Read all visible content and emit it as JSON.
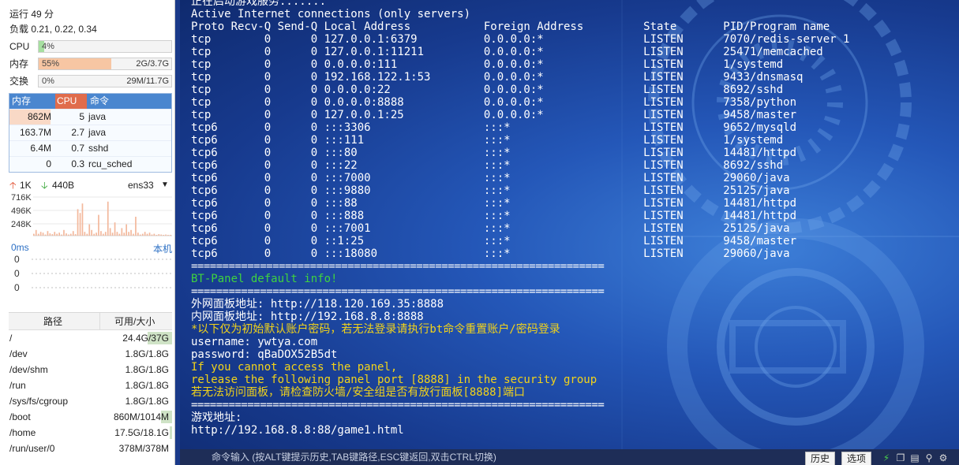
{
  "sidebar": {
    "uptime": "运行 49 分",
    "load": "负载 0.21, 0.22, 0.34",
    "cpu": {
      "label": "CPU",
      "pct_text": "4%",
      "value": 0.04,
      "color": "#a6dfa0"
    },
    "mem": {
      "label": "内存",
      "pct_text": "55%",
      "amount": "2G/3.7G",
      "value": 0.55,
      "color": "#f7c6a3"
    },
    "swap": {
      "label": "交换",
      "pct_text": "0%",
      "amount": "29M/11.7G",
      "value": 0.0,
      "color": "#cfe3f7"
    },
    "process_table": {
      "headers": {
        "mem": "内存",
        "cpu": "CPU",
        "cmd": "命令"
      },
      "rows": [
        {
          "mem": "862M",
          "cpu": "5",
          "cmd": "java",
          "mem_frac": 0.25
        },
        {
          "mem": "163.7M",
          "cpu": "2.7",
          "cmd": "java",
          "mem_frac": 0.0
        },
        {
          "mem": "6.4M",
          "cpu": "0.7",
          "cmd": "sshd",
          "mem_frac": 0.0
        },
        {
          "mem": "0",
          "cpu": "0.3",
          "cmd": "rcu_sched",
          "mem_frac": 0.0
        }
      ]
    },
    "network": {
      "up": "1K",
      "down": "440B",
      "iface": "ens33",
      "scale": [
        "716K",
        "496K",
        "248K"
      ],
      "bars": [
        0.05,
        0.15,
        0.05,
        0.1,
        0.08,
        0.03,
        0.12,
        0.06,
        0.04,
        0.1,
        0.05,
        0.08,
        0.03,
        0.15,
        0.06,
        0.03,
        0.05,
        0.12,
        0.04,
        0.7,
        0.6,
        0.85,
        0.1,
        0.05,
        0.3,
        0.15,
        0.05,
        0.08,
        0.55,
        0.12,
        0.05,
        0.1,
        0.9,
        0.2,
        0.08,
        0.35,
        0.1,
        0.05,
        0.2,
        0.08,
        0.3,
        0.1,
        0.15,
        0.05,
        0.5,
        0.08,
        0.03,
        0.05,
        0.1,
        0.05,
        0.08,
        0.03,
        0.05,
        0.02,
        0.04,
        0.03,
        0.02,
        0.03,
        0.02,
        0.02
      ],
      "up_color": "#e04a2a",
      "down_color": "#2aa02a",
      "bar_color": "#f3b89c"
    },
    "latency": {
      "label": "0ms",
      "target": "本机",
      "scale": [
        "0",
        "0",
        "0"
      ]
    },
    "disk_table": {
      "headers": {
        "path": "路径",
        "size": "可用/大小"
      },
      "rows": [
        {
          "path": "/",
          "size": "24.4G/37G",
          "used_frac": 0.34
        },
        {
          "path": "/dev",
          "size": "1.8G/1.8G",
          "used_frac": 0.0
        },
        {
          "path": "/dev/shm",
          "size": "1.8G/1.8G",
          "used_frac": 0.0
        },
        {
          "path": "/run",
          "size": "1.8G/1.8G",
          "used_frac": 0.0
        },
        {
          "path": "/sys/fs/cgroup",
          "size": "1.8G/1.8G",
          "used_frac": 0.0
        },
        {
          "path": "/boot",
          "size": "860M/1014M",
          "used_frac": 0.15
        },
        {
          "path": "/home",
          "size": "17.5G/18.1G",
          "used_frac": 0.03
        },
        {
          "path": "/run/user/0",
          "size": "378M/378M",
          "used_frac": 0.0
        }
      ]
    }
  },
  "terminal": {
    "lines": [
      {
        "text": "正在启动游戏服务.......",
        "color": "w"
      },
      {
        "text": "Active Internet connections (only servers)",
        "color": "w"
      },
      {
        "text": "Proto Recv-Q Send-Q Local Address           Foreign Address         State       PID/Program name",
        "color": "w"
      },
      {
        "text": "tcp        0      0 127.0.0.1:6379          0.0.0.0:*               LISTEN      7070/redis-server 1",
        "color": "w"
      },
      {
        "text": "tcp        0      0 127.0.0.1:11211         0.0.0.0:*               LISTEN      25471/memcached",
        "color": "w"
      },
      {
        "text": "tcp        0      0 0.0.0.0:111             0.0.0.0:*               LISTEN      1/systemd",
        "color": "w"
      },
      {
        "text": "tcp        0      0 192.168.122.1:53        0.0.0.0:*               LISTEN      9433/dnsmasq",
        "color": "w"
      },
      {
        "text": "tcp        0      0 0.0.0.0:22              0.0.0.0:*               LISTEN      8692/sshd",
        "color": "w"
      },
      {
        "text": "tcp        0      0 0.0.0.0:8888            0.0.0.0:*               LISTEN      7358/python",
        "color": "w"
      },
      {
        "text": "tcp        0      0 127.0.0.1:25            0.0.0.0:*               LISTEN      9458/master",
        "color": "w"
      },
      {
        "text": "tcp6       0      0 :::3306                 :::*                    LISTEN      9652/mysqld",
        "color": "w"
      },
      {
        "text": "tcp6       0      0 :::111                  :::*                    LISTEN      1/systemd",
        "color": "w"
      },
      {
        "text": "tcp6       0      0 :::80                   :::*                    LISTEN      14481/httpd",
        "color": "w"
      },
      {
        "text": "tcp6       0      0 :::22                   :::*                    LISTEN      8692/sshd",
        "color": "w"
      },
      {
        "text": "tcp6       0      0 :::7000                 :::*                    LISTEN      29060/java",
        "color": "w"
      },
      {
        "text": "tcp6       0      0 :::9880                 :::*                    LISTEN      25125/java",
        "color": "w"
      },
      {
        "text": "tcp6       0      0 :::88                   :::*                    LISTEN      14481/httpd",
        "color": "w"
      },
      {
        "text": "tcp6       0      0 :::888                  :::*                    LISTEN      14481/httpd",
        "color": "w"
      },
      {
        "text": "tcp6       0      0 :::7001                 :::*                    LISTEN      25125/java",
        "color": "w"
      },
      {
        "text": "tcp6       0      0 ::1:25                  :::*                    LISTEN      9458/master",
        "color": "w"
      },
      {
        "text": "tcp6       0      0 :::18080                :::*                    LISTEN      29060/java",
        "color": "w"
      },
      {
        "text": "==================================================================",
        "color": "sep"
      },
      {
        "text": "BT-Panel default info!",
        "color": "g"
      },
      {
        "text": "==================================================================",
        "color": "sep"
      },
      {
        "text": "外网面板地址: http://118.120.169.35:8888",
        "color": "w"
      },
      {
        "text": "内网面板地址: http://192.168.8.8:8888",
        "color": "w"
      },
      {
        "text": "*以下仅为初始默认账户密码，若无法登录请执行bt命令重置账户/密码登录",
        "color": "y"
      },
      {
        "text": "username: ywtya.com",
        "color": "w"
      },
      {
        "text": "password: qBaDOX52B5dt",
        "color": "w"
      },
      {
        "text": "If you cannot access the panel,",
        "color": "y"
      },
      {
        "text": "release the following panel port [8888] in the security group",
        "color": "y"
      },
      {
        "text": "若无法访问面板，请检查防火墙/安全组是否有放行面板[8888]端口",
        "color": "y"
      },
      {
        "text": "==================================================================",
        "color": "sep"
      },
      {
        "text": "游戏地址:",
        "color": "w"
      },
      {
        "text": "http://192.168.8.8:88/game1.html",
        "color": "w"
      }
    ]
  },
  "bottombar": {
    "input_placeholder": "命令输入 (按ALT键提示历史,TAB键路径,ESC键返回,双击CTRL切换)",
    "history_label": "历史",
    "options_label": "选项",
    "icons": [
      "lightning-icon",
      "copy-icon",
      "paste-icon",
      "search-icon",
      "settings-icon"
    ]
  }
}
